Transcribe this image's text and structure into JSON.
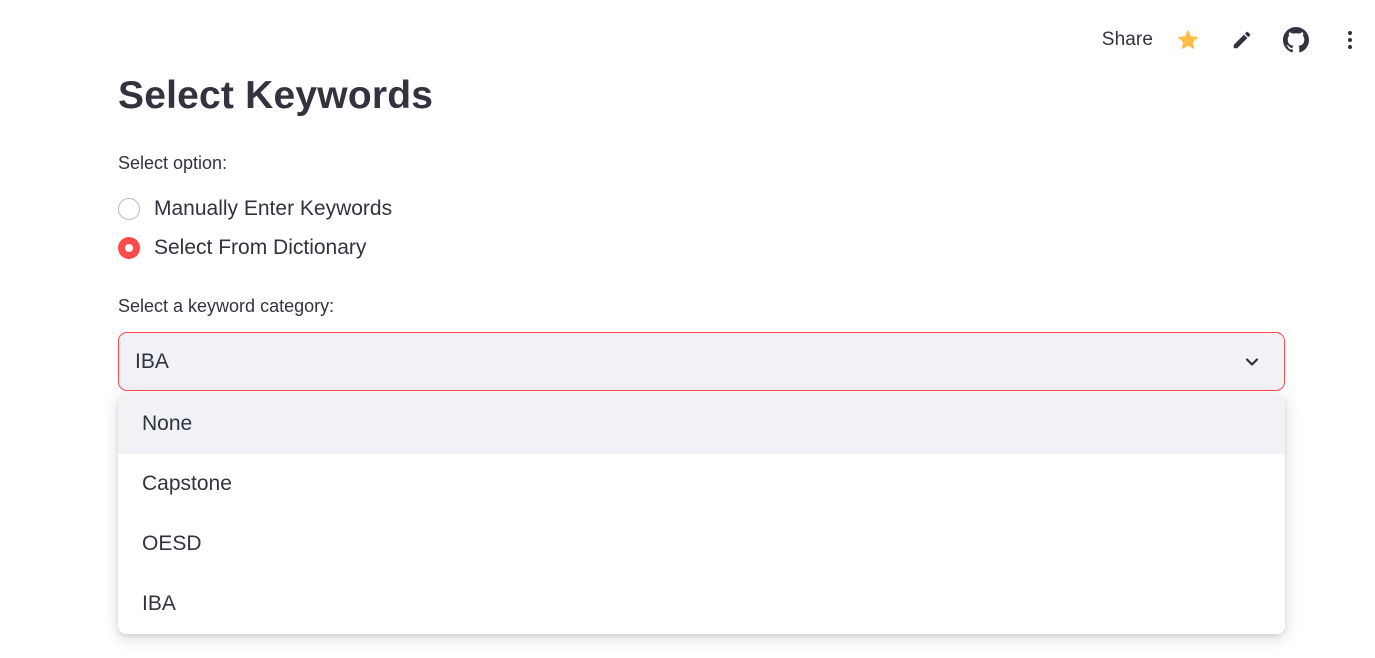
{
  "toolbar": {
    "share_label": "Share",
    "icons": [
      "star-icon",
      "pencil-icon",
      "github-icon",
      "more-vertical-icon"
    ],
    "star_color": "#ffbd45"
  },
  "main": {
    "title": "Select Keywords",
    "option_label": "Select option:",
    "radio_options": [
      {
        "label": "Manually Enter Keywords",
        "checked": false
      },
      {
        "label": "Select From Dictionary",
        "checked": true
      }
    ],
    "category_label": "Select a keyword category:",
    "category_select": {
      "value": "IBA",
      "options": [
        "None",
        "Capstone",
        "OESD",
        "IBA"
      ],
      "highlighted": "None"
    }
  },
  "colors": {
    "accent": "#ff4b4b",
    "text": "#31333f",
    "input_bg": "#f0f2f6"
  }
}
